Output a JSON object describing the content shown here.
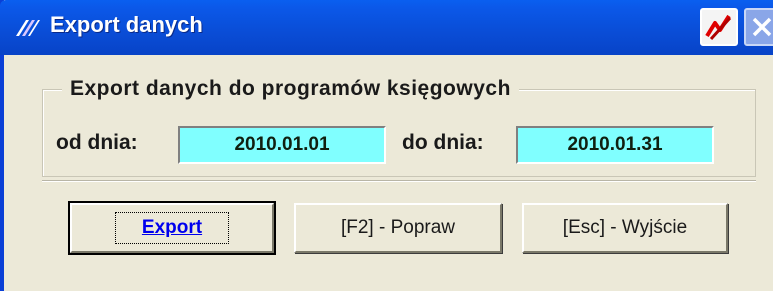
{
  "window": {
    "title": "Export danych",
    "app_icon": "app-logo-icon",
    "titlebar_buttons": [
      "app-status-icon",
      "close-icon"
    ],
    "titlebar_color": "#0a4ed8"
  },
  "group": {
    "legend": "Export danych do programów księgowych"
  },
  "date_from": {
    "label": "od dnia:",
    "value": "2010.01.01"
  },
  "date_to": {
    "label": "do dnia:",
    "value": "2010.01.31"
  },
  "buttons": {
    "export": "Export",
    "fix": "[F2] - Popraw",
    "exit": "[Esc] - Wyjście"
  },
  "colors": {
    "field_bg": "#80ffff",
    "face": "#ece9d8",
    "link": "#0000ee"
  }
}
